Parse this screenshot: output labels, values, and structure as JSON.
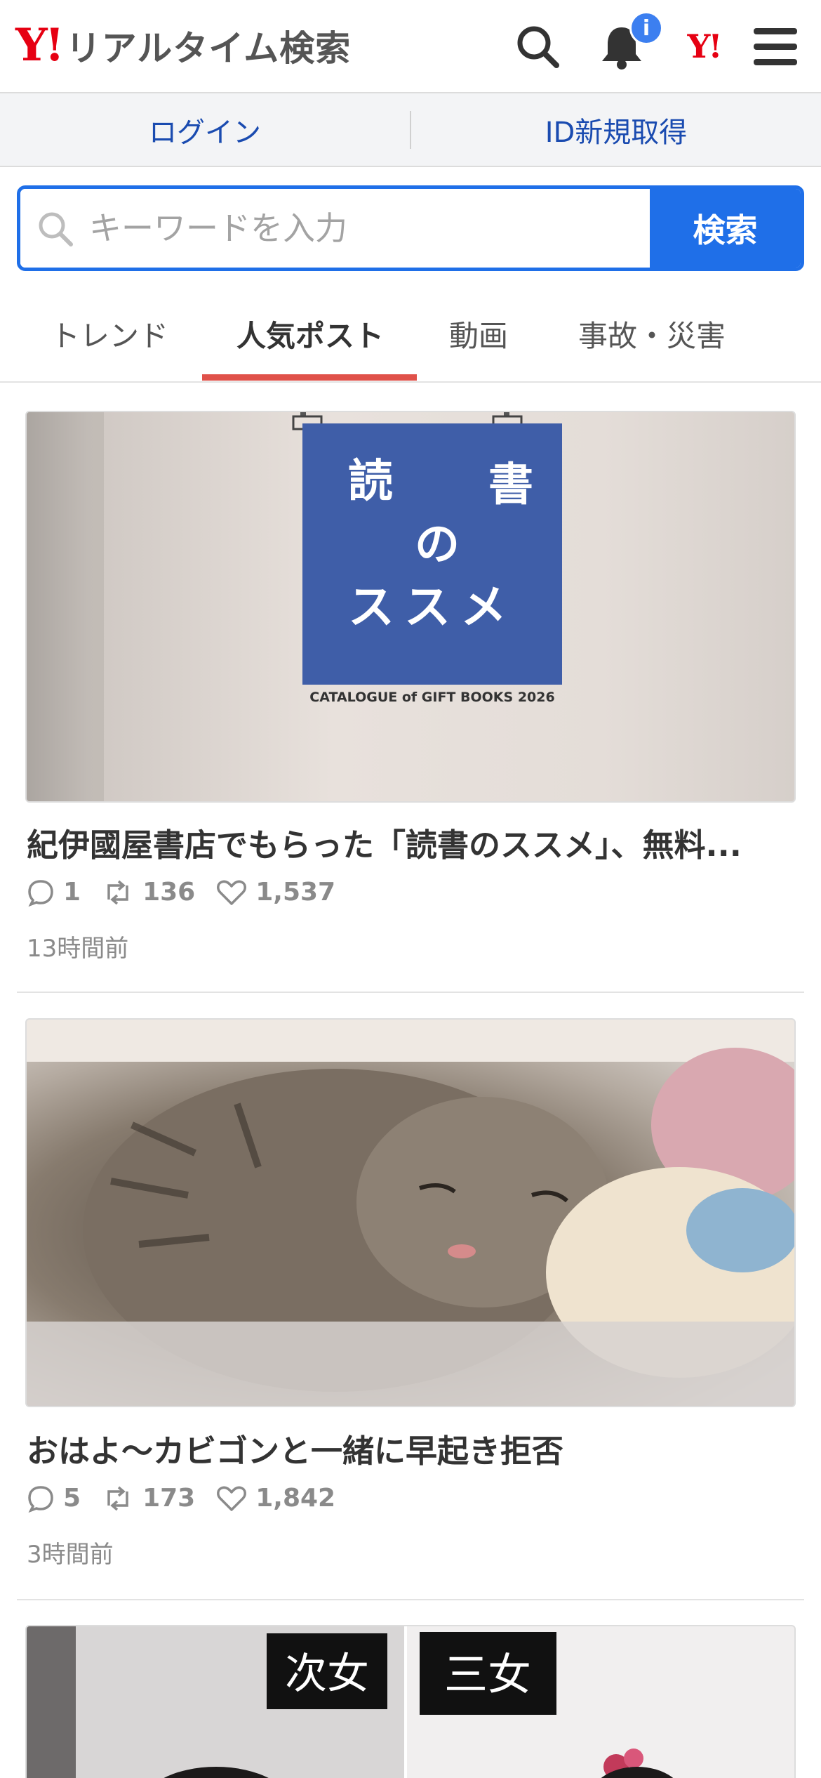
{
  "header": {
    "logo_mark": "Y!",
    "logo_text": "リアルタイム検索",
    "badge": "i",
    "yj_mark": "Y!",
    "icons": [
      "search-icon",
      "bell-icon",
      "yahoo-japan-icon",
      "menu-icon"
    ]
  },
  "login_bar": {
    "login": "ログイン",
    "signup": "ID新規取得"
  },
  "search": {
    "placeholder": "キーワードを入力",
    "button": "検索"
  },
  "tabs": [
    {
      "label": "トレンド",
      "active": false
    },
    {
      "label": "人気ポスト",
      "active": true
    },
    {
      "label": "動画",
      "active": false
    },
    {
      "label": "事故・災害",
      "active": false
    }
  ],
  "posts": [
    {
      "image_text": {
        "line1_left": "読",
        "line1_right": "書",
        "line2": "の",
        "line3": "ススメ",
        "caption": "CATALOGUE of GIFT BOOKS 2026"
      },
      "title": "紀伊國屋書店でもらった「読書のススメ」、無料...",
      "replies": "1",
      "reposts": "136",
      "likes": "1,537",
      "time": "13時間前"
    },
    {
      "title": "おはよ〜カビゴンと一緒に早起き拒否",
      "replies": "5",
      "reposts": "173",
      "likes": "1,842",
      "time": "3時間前"
    },
    {
      "image_text": {
        "label_left": "次女",
        "label_right": "三女"
      }
    }
  ],
  "colors": {
    "brand_red": "#e60012",
    "accent_blue": "#1f6fe8",
    "tab_indicator": "#e0514a",
    "link_blue": "#1a4bb0"
  }
}
